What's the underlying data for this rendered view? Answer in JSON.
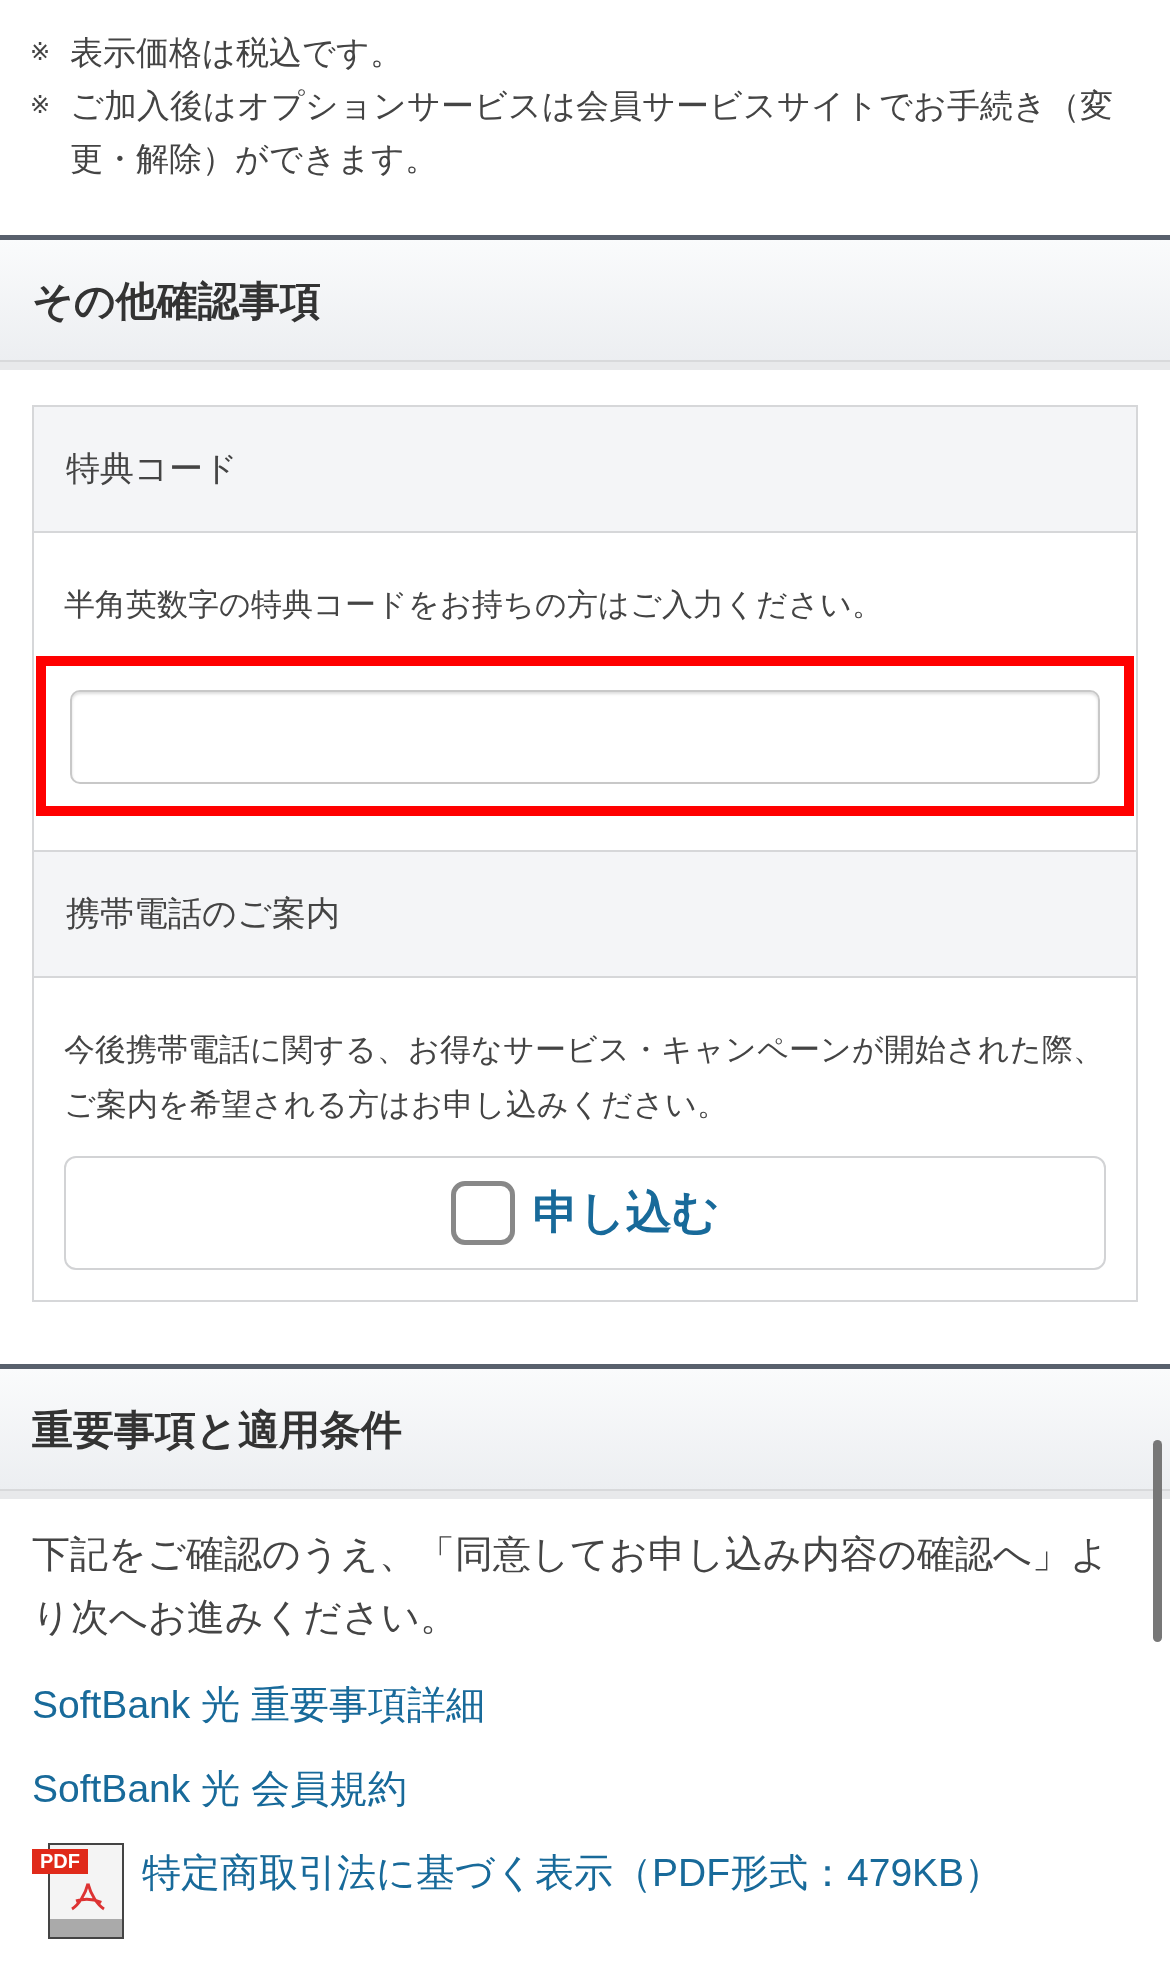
{
  "notes": [
    {
      "mark": "※",
      "text": "表示価格は税込です。"
    },
    {
      "mark": "※",
      "text": "ご加入後はオプションサービスは会員サービスサイトでお手続き（変更・解除）ができます。"
    }
  ],
  "sections": [
    {
      "title": "その他確認事項",
      "kind": "panels",
      "panels": [
        {
          "label": "特典コード",
          "text": "半角英数字の特典コードをお持ちの方はご入力ください。",
          "kind": "input",
          "highlighted": true
        },
        {
          "label": "携帯電話のご案内",
          "text": "今後携帯電話に関する、お得なサービス・キャンペーンが開始された際、ご案内を希望される方はお申し込みください。",
          "kind": "checkbox",
          "button_label": "申し込む",
          "checked": false
        }
      ]
    },
    {
      "title": "重要事項と適用条件",
      "kind": "links",
      "text": "下記をご確認のうえ、「同意してお申し込み内容の確認へ」より次へお進みください。",
      "links": [
        {
          "label": "SoftBank 光 重要事項詳細",
          "kind": "plain"
        },
        {
          "label": "SoftBank 光 会員規約",
          "kind": "plain"
        },
        {
          "label": "特定商取引法に基づく表示（PDF形式：479KB）",
          "kind": "pdf",
          "icon_label": "PDF"
        }
      ]
    }
  ]
}
